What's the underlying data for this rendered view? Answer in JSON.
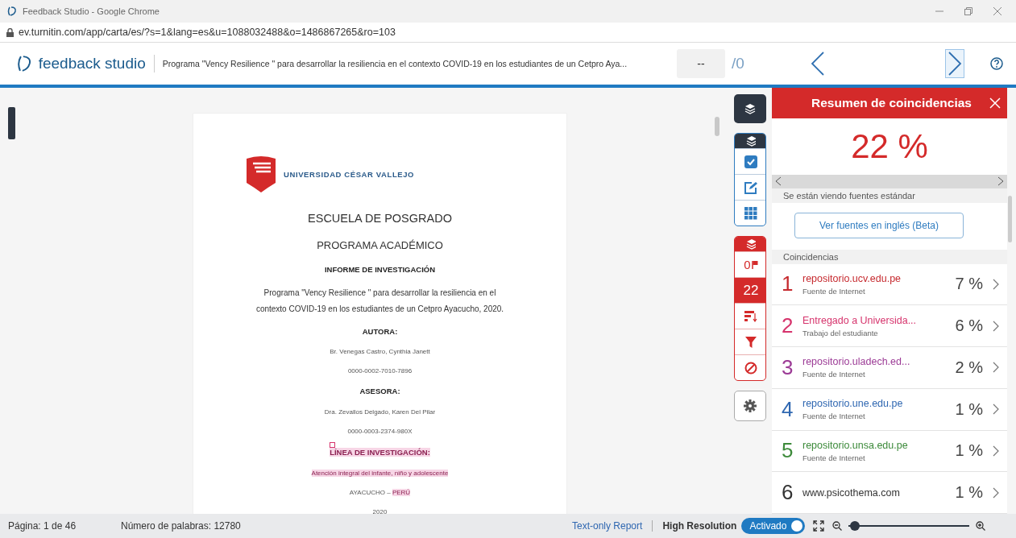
{
  "browser": {
    "title": "Feedback Studio - Google Chrome",
    "url": "ev.turnitin.com/app/carta/es/?s=1&lang=es&u=1088032488&o=1486867265&ro=103"
  },
  "header": {
    "brand": "feedback studio",
    "document_title": "Programa \"Vency Resilience \" para desarrollar la resiliencia en el contexto COVID-19 en los estudiantes de un Cetpro Aya...",
    "page_field": {
      "value": "--"
    },
    "page_total": "/0"
  },
  "document": {
    "university": "UNIVERSIDAD CÉSAR VALLEJO",
    "lines": [
      {
        "kind": "title",
        "segments": [
          {
            "text": "ESCUELA DE POSGRADO",
            "highlighted": false
          }
        ]
      },
      {
        "kind": "subtitle",
        "segments": [
          {
            "text": "PROGRAMA ACADÉMICO",
            "highlighted": false
          }
        ]
      },
      {
        "kind": "bold",
        "segments": [
          {
            "text": "INFORME DE INVESTIGACIÓN",
            "highlighted": false
          }
        ]
      },
      {
        "kind": "body",
        "segments": [
          {
            "text": "Programa \"Vency Resilience \" para desarrollar la resiliencia en el contexto COVID-19 en los estudiantes de un Cetpro Ayacucho, 2020.",
            "highlighted": false
          }
        ]
      },
      {
        "kind": "bold",
        "segments": [
          {
            "text": "AUTORA:",
            "highlighted": false
          }
        ]
      },
      {
        "kind": "small",
        "segments": [
          {
            "text": "Br. Venegas Castro, Cynthia Janett",
            "highlighted": false
          }
        ]
      },
      {
        "kind": "small",
        "segments": [
          {
            "text": "0000-0002-7010-7896",
            "highlighted": false
          }
        ]
      },
      {
        "kind": "bold",
        "segments": [
          {
            "text": "ASESORA:",
            "highlighted": false
          }
        ]
      },
      {
        "kind": "small",
        "segments": [
          {
            "text": "Dra. Zevallos Delgado, Karen Del Pilar",
            "highlighted": false
          }
        ]
      },
      {
        "kind": "small",
        "segments": [
          {
            "text": "0000-0003-2374-980X",
            "highlighted": false
          }
        ]
      },
      {
        "kind": "bold",
        "marked": true,
        "segments": [
          {
            "text": "LÍNEA DE INVESTIGACIÓN:",
            "highlighted": true
          }
        ]
      },
      {
        "kind": "small",
        "segments": [
          {
            "text": "Atención integral del infante, niño y adolescente",
            "highlighted": true
          }
        ]
      },
      {
        "kind": "small",
        "segments": [
          {
            "text": "AYACUCHO – ",
            "highlighted": false
          },
          {
            "text": "PERÚ",
            "highlighted": true
          }
        ]
      },
      {
        "kind": "small",
        "segments": [
          {
            "text": "2020",
            "highlighted": false
          }
        ]
      }
    ]
  },
  "tools": {
    "flag_count": "0",
    "match_tool": {
      "label": "22",
      "selected": true
    }
  },
  "panel": {
    "title": "Resumen de coincidencias",
    "score": "22 %",
    "view_note": "Se están viendo fuentes estándar",
    "english_button": "Ver fuentes en inglés (Beta)",
    "section": "Coincidencias",
    "sources": [
      {
        "number": "1",
        "name": "repositorio.ucv.edu.pe",
        "type": "Fuente de Internet",
        "percent": "7 %",
        "color": "#c62a2f"
      },
      {
        "number": "2",
        "name": "Entregado a Universida...",
        "type": "Trabajo del estudiante",
        "percent": "6 %",
        "color": "#d6336c"
      },
      {
        "number": "3",
        "name": "repositorio.uladech.ed...",
        "type": "Fuente de Internet",
        "percent": "2 %",
        "color": "#9c3b96"
      },
      {
        "number": "4",
        "name": "repositorio.une.edu.pe",
        "type": "Fuente de Internet",
        "percent": "1 %",
        "color": "#2f67b1"
      },
      {
        "number": "5",
        "name": "repositorio.unsa.edu.pe",
        "type": "Fuente de Internet",
        "percent": "1 %",
        "color": "#3c8a3a"
      },
      {
        "number": "6",
        "name": "www.psicothema.com",
        "percent": "1 %",
        "color": "#333333"
      }
    ]
  },
  "footer": {
    "page": "Página: 1 de 46",
    "words": "Número de palabras: 12780",
    "text_only": "Text-only Report",
    "resolution_label": "High Resolution",
    "resolution_toggle": {
      "label": "Activado",
      "on": true
    },
    "zoom": {
      "level": 0.05
    }
  }
}
